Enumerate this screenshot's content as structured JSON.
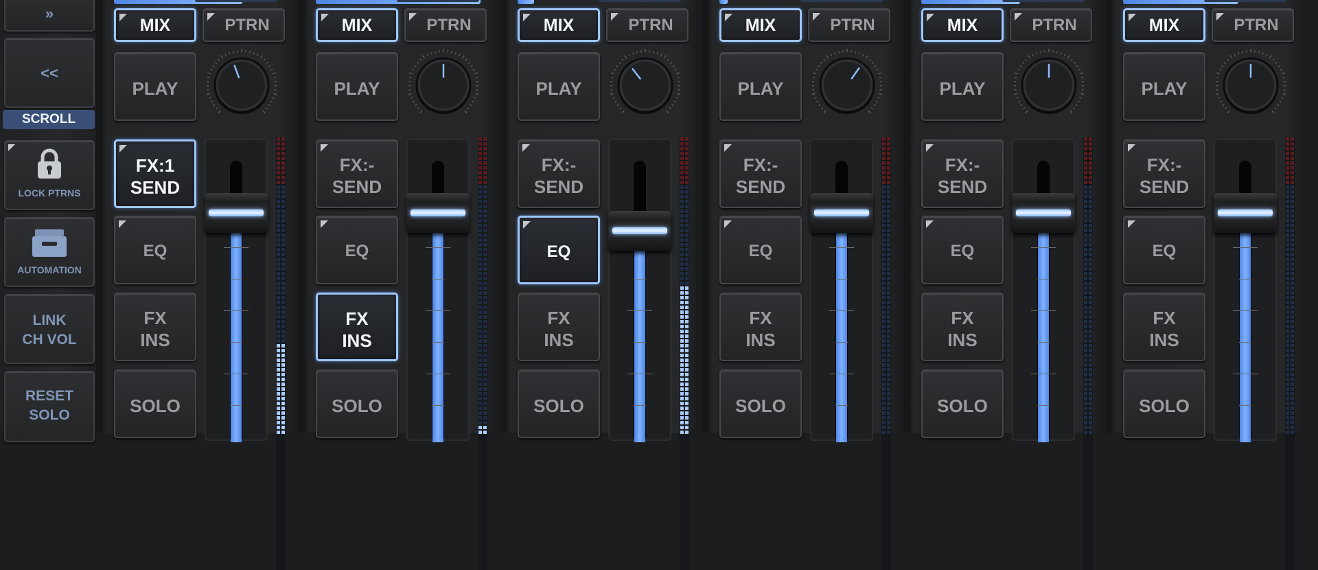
{
  "sidebar": {
    "top_button": "»",
    "scroll_back_label": "<<",
    "scroll_label": "SCROLL",
    "lock_patterns_label": "LOCK PTRNS",
    "automation_label": "AUTOMATION",
    "link_ch_vol_line1": "LINK",
    "link_ch_vol_line2": "CH VOL",
    "reset_solo_line1": "RESET",
    "reset_solo_line2": "SOLO"
  },
  "colors": {
    "accent_blue": "#7fb2ff",
    "active_border": "#9fc7ff",
    "meter_red": "#6b1f1f",
    "meter_blue": "#9ec4ff",
    "sidebar_text": "#8096b6"
  },
  "channels": [
    {
      "mix": "MIX",
      "ptrn": "PTRN",
      "play": "PLAY",
      "fx_line1": "FX:1",
      "fx_line2": "SEND",
      "eq": "EQ",
      "ins_line1": "FX",
      "ins_line2": "INS",
      "solo": "SOLO",
      "fx_send_active": true,
      "eq_active": false,
      "ins_active": false,
      "knob_angle_deg": -20,
      "fader_level": 0.82,
      "meter_level": 0.32,
      "top_bar_fraction": 0.78
    },
    {
      "mix": "MIX",
      "ptrn": "PTRN",
      "play": "PLAY",
      "fx_line1": "FX:-",
      "fx_line2": "SEND",
      "eq": "EQ",
      "ins_line1": "FX",
      "ins_line2": "INS",
      "solo": "SOLO",
      "fx_send_active": false,
      "eq_active": false,
      "ins_active": true,
      "knob_angle_deg": 0,
      "fader_level": 0.82,
      "meter_level": 0.04,
      "top_bar_fraction": 1.0
    },
    {
      "mix": "MIX",
      "ptrn": "PTRN",
      "play": "PLAY",
      "fx_line1": "FX:-",
      "fx_line2": "SEND",
      "eq": "EQ",
      "ins_line1": "FX",
      "ins_line2": "INS",
      "solo": "SOLO",
      "fx_send_active": false,
      "eq_active": true,
      "ins_active": false,
      "knob_angle_deg": -38,
      "fader_level": 0.72,
      "meter_level": 0.5,
      "top_bar_fraction": 0.1
    },
    {
      "mix": "MIX",
      "ptrn": "PTRN",
      "play": "PLAY",
      "fx_line1": "FX:-",
      "fx_line2": "SEND",
      "eq": "EQ",
      "ins_line1": "FX",
      "ins_line2": "INS",
      "solo": "SOLO",
      "fx_send_active": false,
      "eq_active": false,
      "ins_active": false,
      "knob_angle_deg": 35,
      "fader_level": 0.82,
      "meter_level": 0.0,
      "top_bar_fraction": 0.05
    },
    {
      "mix": "MIX",
      "ptrn": "PTRN",
      "play": "PLAY",
      "fx_line1": "FX:-",
      "fx_line2": "SEND",
      "eq": "EQ",
      "ins_line1": "FX",
      "ins_line2": "INS",
      "solo": "SOLO",
      "fx_send_active": false,
      "eq_active": false,
      "ins_active": false,
      "knob_angle_deg": 0,
      "fader_level": 0.82,
      "meter_level": 0.0,
      "top_bar_fraction": 0.6
    },
    {
      "mix": "MIX",
      "ptrn": "PTRN",
      "play": "PLAY",
      "fx_line1": "FX:-",
      "fx_line2": "SEND",
      "eq": "EQ",
      "ins_line1": "FX",
      "ins_line2": "INS",
      "solo": "SOLO",
      "fx_send_active": false,
      "eq_active": false,
      "ins_active": false,
      "knob_angle_deg": 0,
      "fader_level": 0.82,
      "meter_level": 0.0,
      "top_bar_fraction": 0.7
    }
  ]
}
